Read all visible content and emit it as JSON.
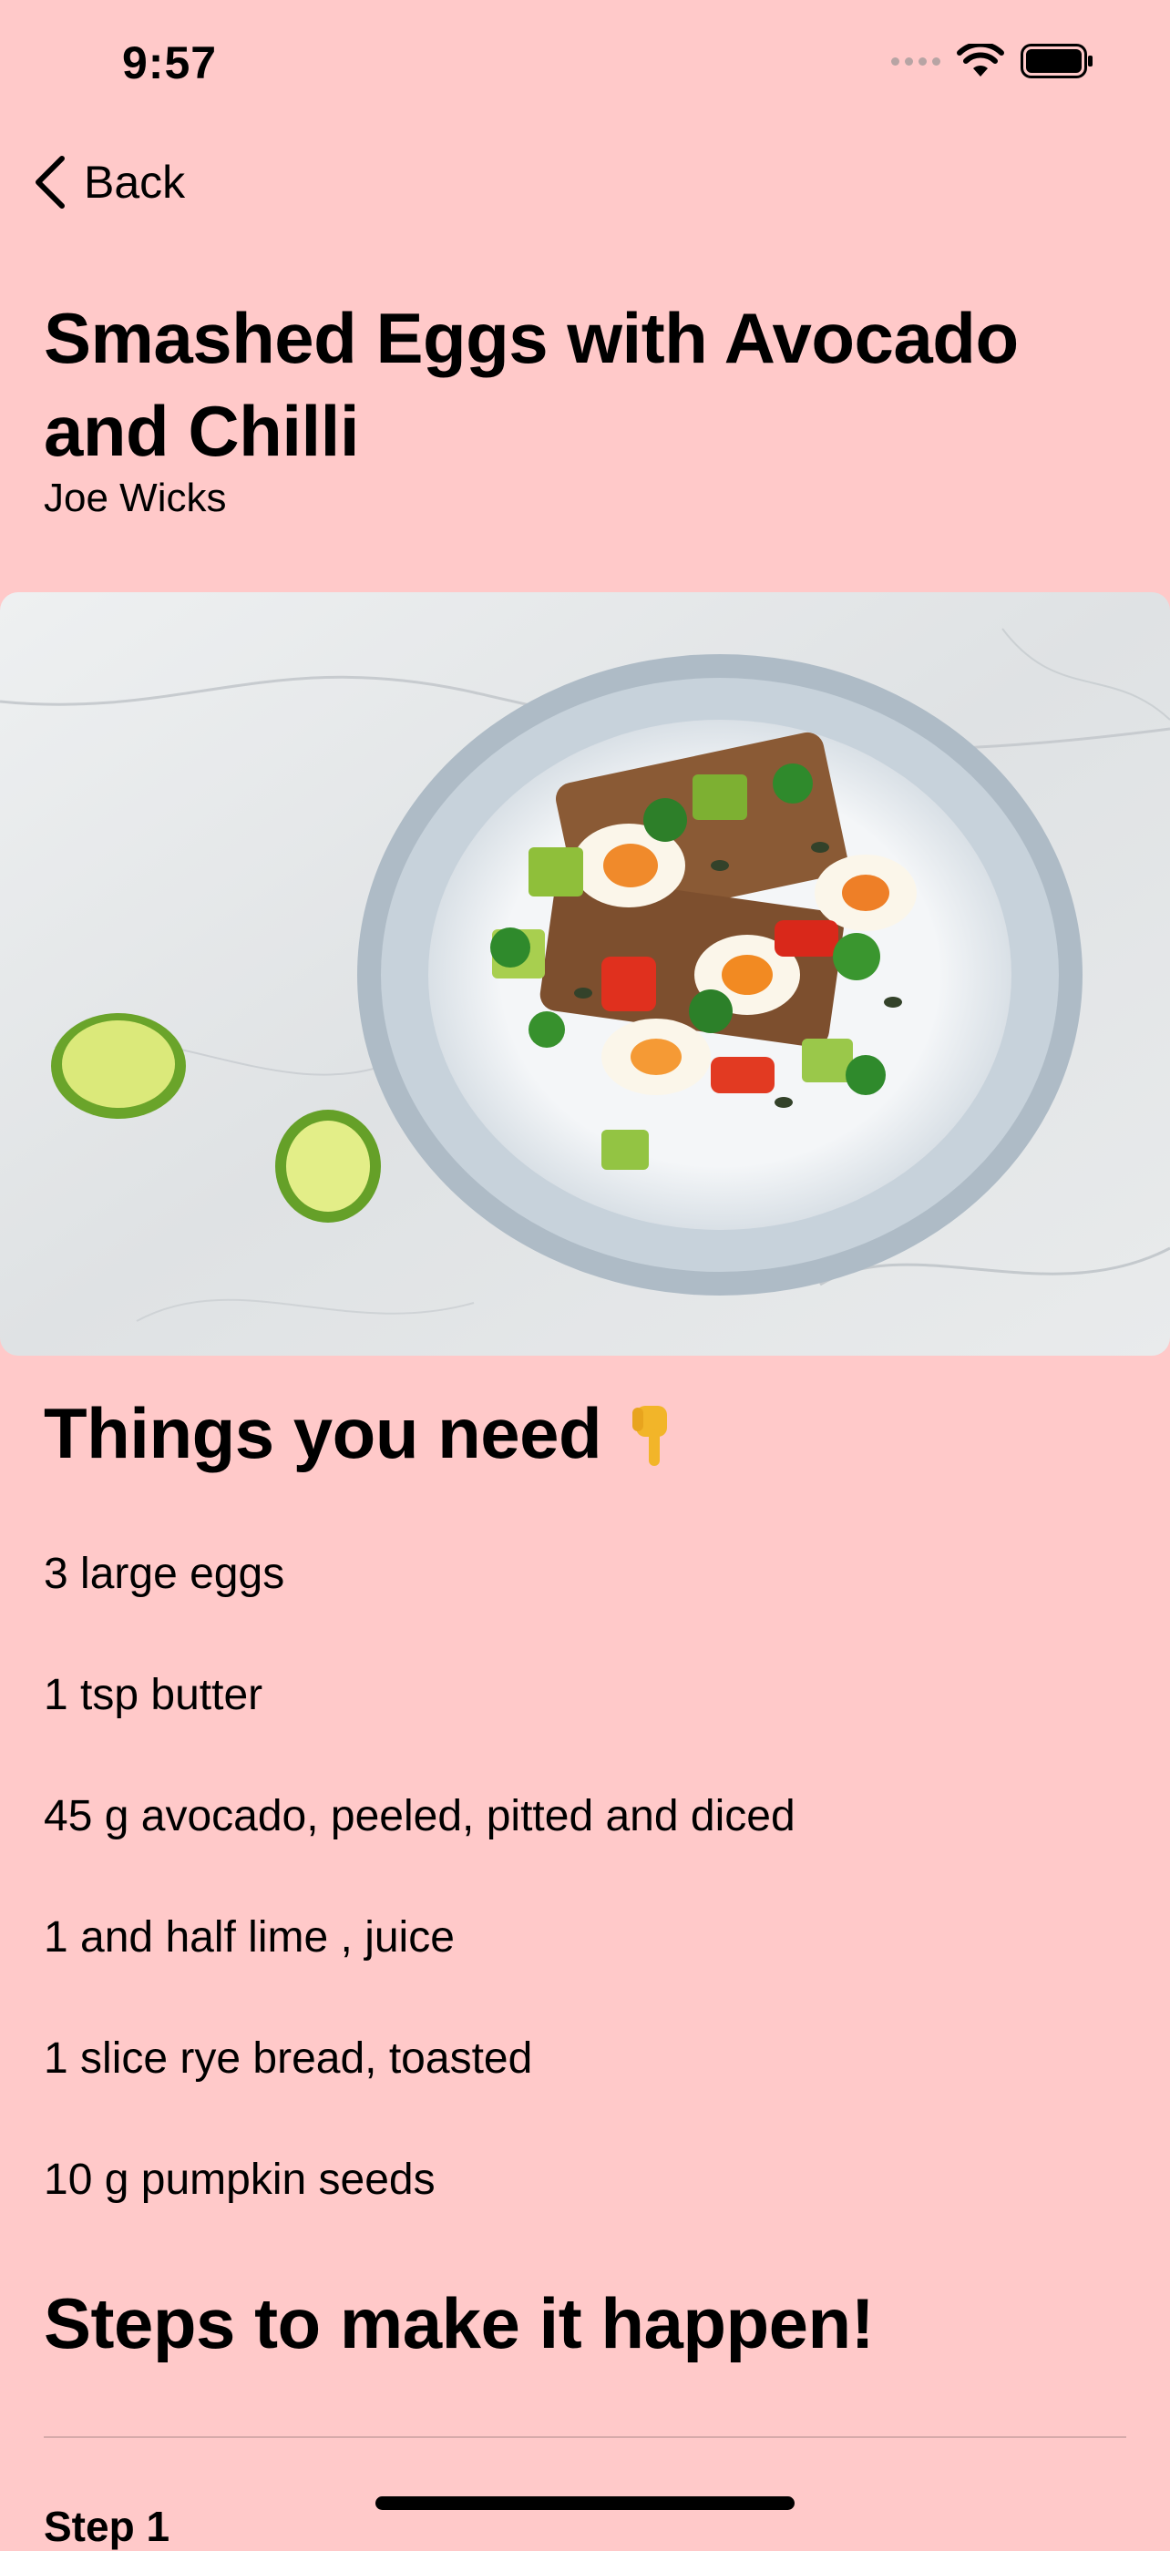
{
  "status_bar": {
    "time": "9:57"
  },
  "nav": {
    "back_label": "Back"
  },
  "recipe": {
    "title": "Smashed Eggs with Avocado and Chilli",
    "author": "Joe Wicks"
  },
  "ingredients_section": {
    "heading": "Things you need",
    "heading_emoji_icon": "pointing-down-hand-icon",
    "items": [
      "3 large eggs",
      "1 tsp butter",
      "45 g avocado, peeled, pitted and diced",
      "1  and half lime , juice",
      "1 slice rye bread, toasted",
      "10 g pumpkin seeds"
    ]
  },
  "steps_section": {
    "heading": "Steps to make it happen!",
    "first_step_label": "Step 1"
  },
  "colors": {
    "background": "#FFC9C9",
    "text": "#000000"
  }
}
